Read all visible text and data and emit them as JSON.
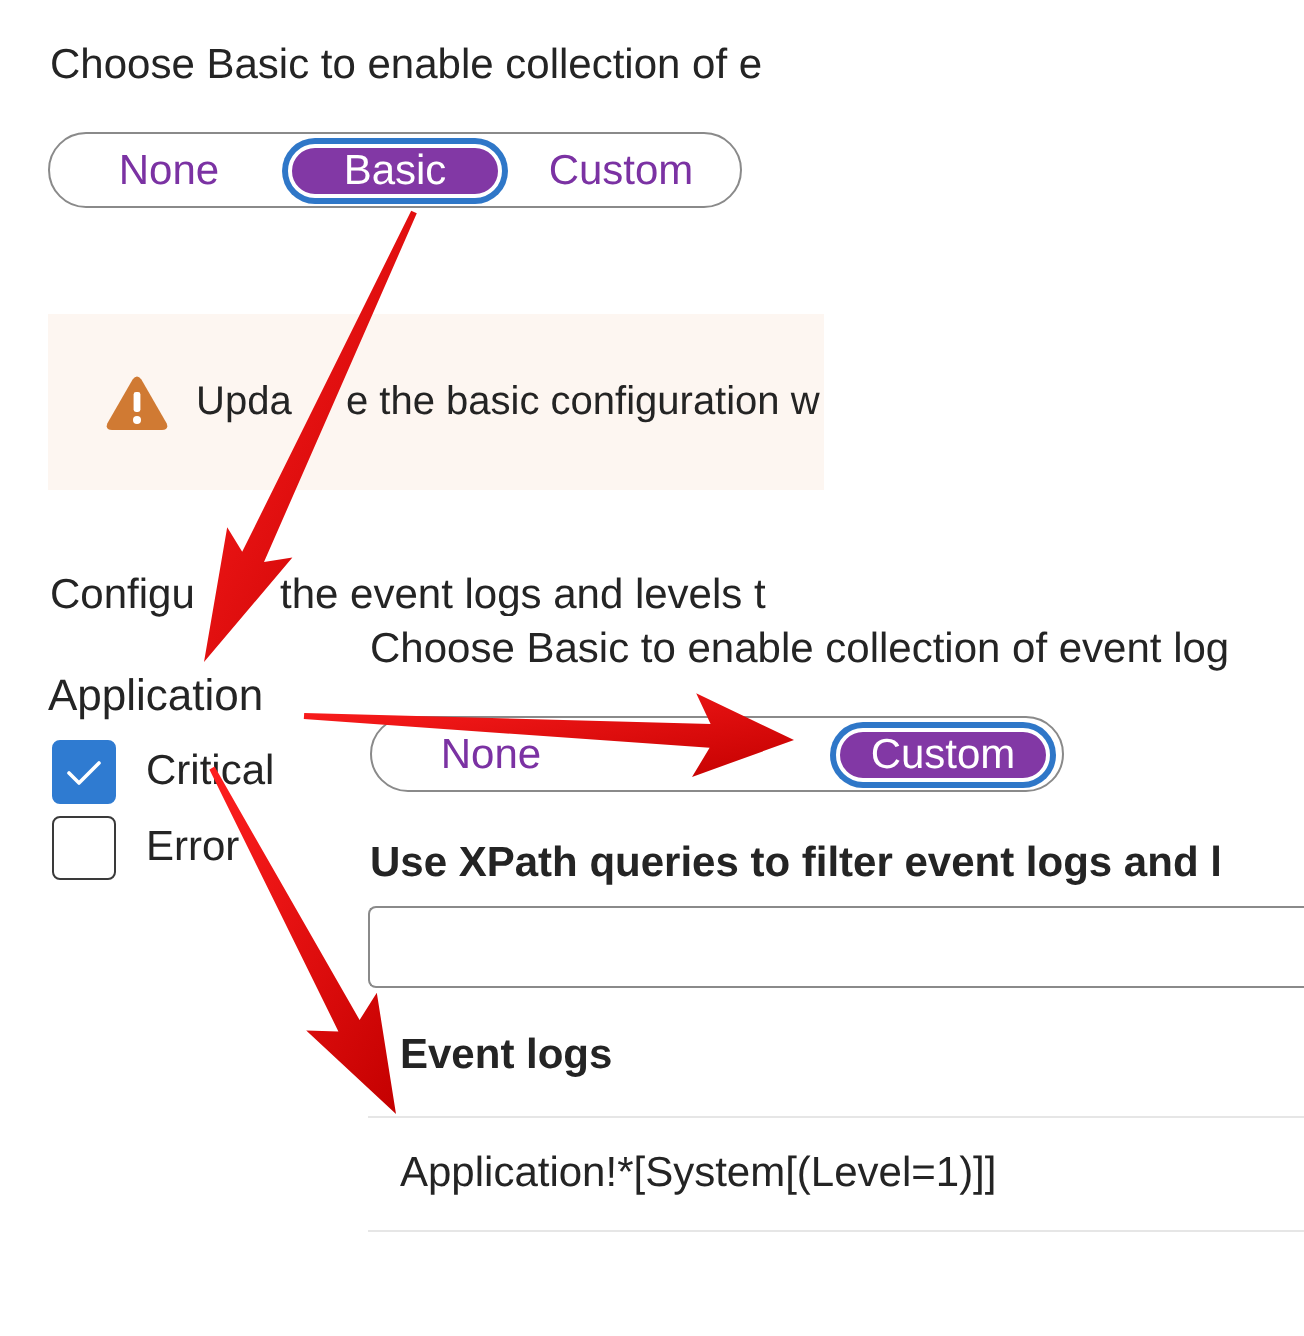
{
  "back_panel": {
    "intro": "Choose Basic to enable collection of e",
    "collection_options": [
      {
        "label": "None",
        "selected": false
      },
      {
        "label": "Basic",
        "selected": true
      },
      {
        "label": "Custom",
        "selected": false
      }
    ],
    "warning": {
      "text_parts": [
        "Upda",
        "e the basic configuration w"
      ]
    },
    "configure_text_parts": [
      "Configu",
      "the event logs and levels t"
    ],
    "log_group": {
      "title": "Application",
      "levels": [
        {
          "label": "Critical",
          "checked": true
        },
        {
          "label": "Error",
          "checked": false
        }
      ]
    }
  },
  "front_panel": {
    "intro": "Choose Basic to enable collection of event log",
    "collection_options": [
      {
        "label": "None",
        "selected": false
      },
      {
        "label": "Custom",
        "selected": true
      }
    ],
    "xpath_label": "Use XPath queries to filter event logs and l",
    "table": {
      "columns": [
        "Event logs"
      ],
      "rows": [
        {
          "cells": [
            "Application!*[System[(Level=1)]]"
          ]
        }
      ]
    }
  }
}
